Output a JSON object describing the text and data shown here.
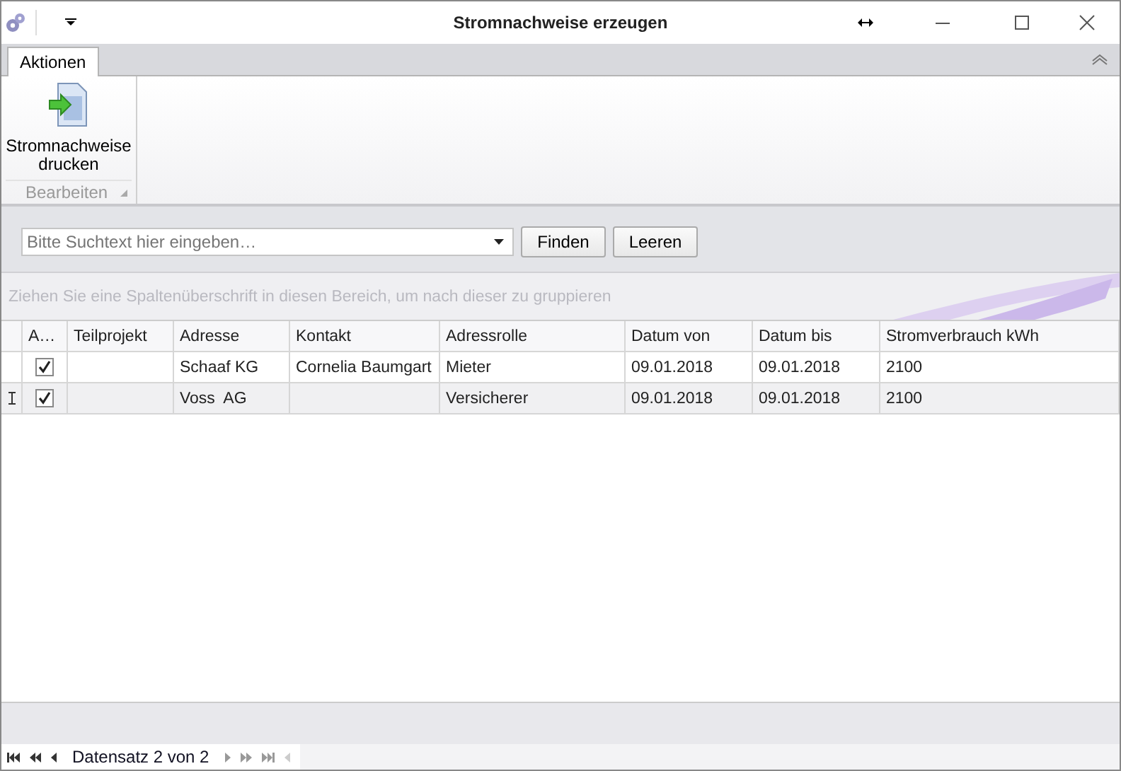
{
  "window": {
    "title": "Stromnachweise erzeugen"
  },
  "ribbon": {
    "tabs": [
      {
        "label": "Aktionen",
        "selected": true
      }
    ],
    "groups": [
      {
        "label": "Bearbeiten",
        "buttons": [
          {
            "label": "Stromnachweise drucken"
          }
        ]
      }
    ]
  },
  "search": {
    "placeholder": "Bitte Suchtext hier eingeben…",
    "buttons": [
      "Finden",
      "Leeren"
    ]
  },
  "group_panel": {
    "hint": "Ziehen Sie eine Spaltenüberschrift in diesen Bereich, um nach dieser zu gruppieren"
  },
  "table": {
    "check_column": "A…",
    "columns": [
      "Teilprojekt",
      "Adresse",
      "Kontakt",
      "Adressrolle",
      "Datum von",
      "Datum bis",
      "Stromverbrauch kWh"
    ],
    "rows": [
      {
        "selected": false,
        "checked": true,
        "cells": [
          "",
          "Schaaf KG",
          "Cornelia Baumgart",
          "Mieter",
          "09.01.2018",
          "09.01.2018",
          "2100"
        ]
      },
      {
        "selected": true,
        "checked": true,
        "cells": [
          "",
          "Voss  AG",
          "",
          "Versicherer",
          "09.01.2018",
          "09.01.2018",
          "2100"
        ]
      }
    ]
  },
  "navigator": {
    "text": "Datensatz 2 von 2"
  }
}
